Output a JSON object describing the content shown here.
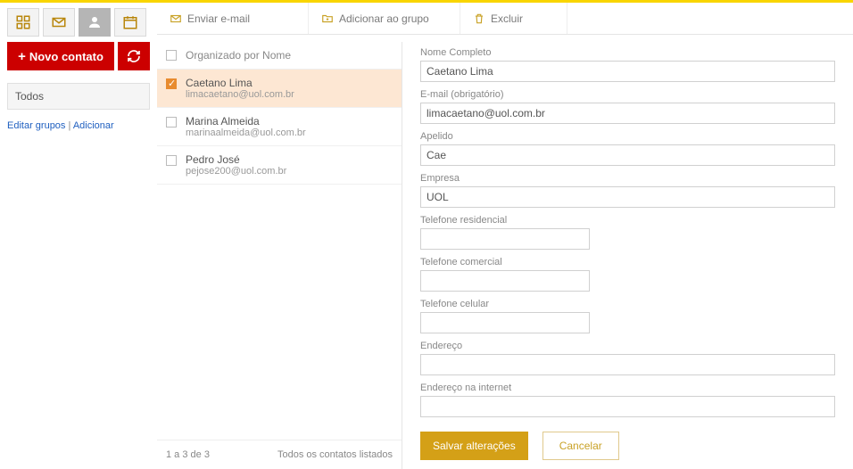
{
  "sidebar": {
    "new_contact_label": "Novo contato",
    "all_label": "Todos",
    "edit_groups_label": "Editar grupos",
    "add_label": "Adicionar"
  },
  "toolbar": {
    "send_email": "Enviar e-mail",
    "add_to_group": "Adicionar ao grupo",
    "delete": "Excluir"
  },
  "list": {
    "header": "Organizado por Nome",
    "footer_count": "1 a 3 de 3",
    "footer_status": "Todos os contatos listados",
    "contacts": [
      {
        "name": "Caetano Lima",
        "email": "limacaetano@uol.com.br",
        "selected": true
      },
      {
        "name": "Marina Almeida",
        "email": "marinaalmeida@uol.com.br",
        "selected": false
      },
      {
        "name": "Pedro José",
        "email": "pejose200@uol.com.br",
        "selected": false
      }
    ]
  },
  "form": {
    "labels": {
      "full_name": "Nome Completo",
      "email": "E-mail (obrigatório)",
      "nickname": "Apelido",
      "company": "Empresa",
      "home_phone": "Telefone residencial",
      "work_phone": "Telefone comercial",
      "mobile": "Telefone celular",
      "address": "Endereço",
      "website": "Endereço na internet"
    },
    "values": {
      "full_name": "Caetano Lima",
      "email": "limacaetano@uol.com.br",
      "nickname": "Cae",
      "company": "UOL",
      "home_phone": "",
      "work_phone": "",
      "mobile": "",
      "address": "",
      "website": ""
    },
    "save_label": "Salvar alterações",
    "cancel_label": "Cancelar"
  },
  "colors": {
    "primary": "#c00",
    "accent": "#d4a017",
    "selection": "#fde7d3"
  }
}
